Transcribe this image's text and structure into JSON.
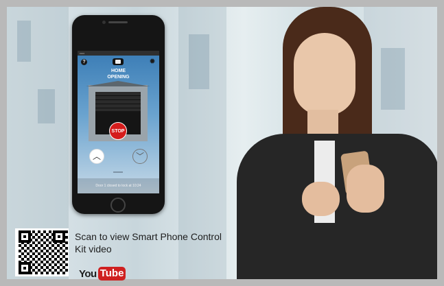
{
  "app_screen": {
    "status_bar": "••••• ",
    "door_name": "HOME",
    "door_status": "OPENING",
    "stop_label": "STOP",
    "up_icon": "chevron-up",
    "down_icon": "chevron-down",
    "message": "Door 1 closed to lock at 10:24"
  },
  "promo": {
    "scan_text": "Scan to view Smart Phone Control Kit video",
    "youtube_you": "You",
    "youtube_tube": "Tube"
  },
  "colors": {
    "stop_red": "#d41c1c",
    "youtube_red": "#cf2020",
    "screen_blue": "#3a7cb5"
  }
}
